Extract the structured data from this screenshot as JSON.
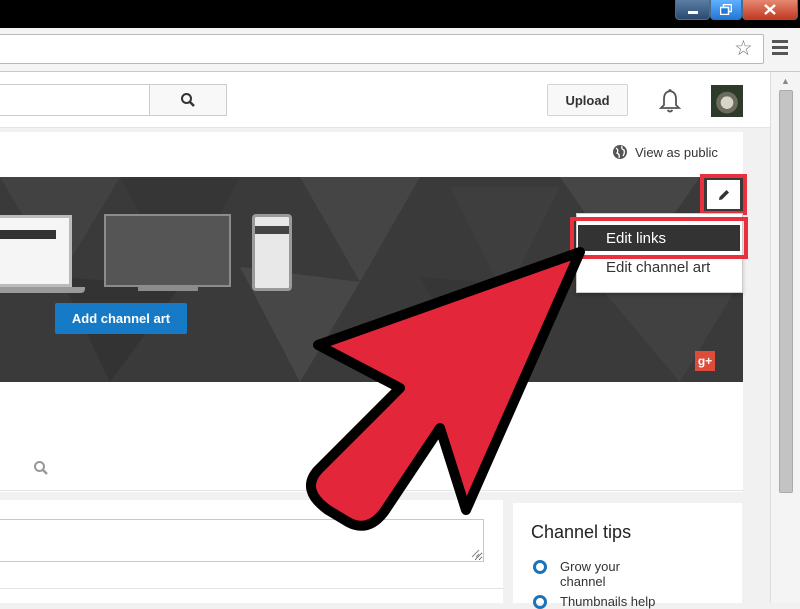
{
  "browser": {
    "omnibox_value": ""
  },
  "masthead": {
    "search_placeholder": "",
    "upload_label": "Upload"
  },
  "channel": {
    "view_as_public": "View as public",
    "add_channel_art": "Add channel art",
    "social_badge": "g+",
    "menu": {
      "edit_links": "Edit links",
      "edit_channel_art": "Edit channel art"
    }
  },
  "tips": {
    "title": "Channel tips",
    "items": [
      "Grow your channel",
      "Thumbnails help"
    ]
  },
  "colors": {
    "highlight": "#e8303f",
    "accent_blue": "#167ac6",
    "google_red": "#dd4b39"
  },
  "icons": [
    "minimize-icon",
    "maximize-icon",
    "close-icon",
    "star-icon",
    "menu-icon",
    "search-icon",
    "bell-icon",
    "globe-icon",
    "pencil-icon",
    "google-plus-icon",
    "arrow-icon"
  ]
}
